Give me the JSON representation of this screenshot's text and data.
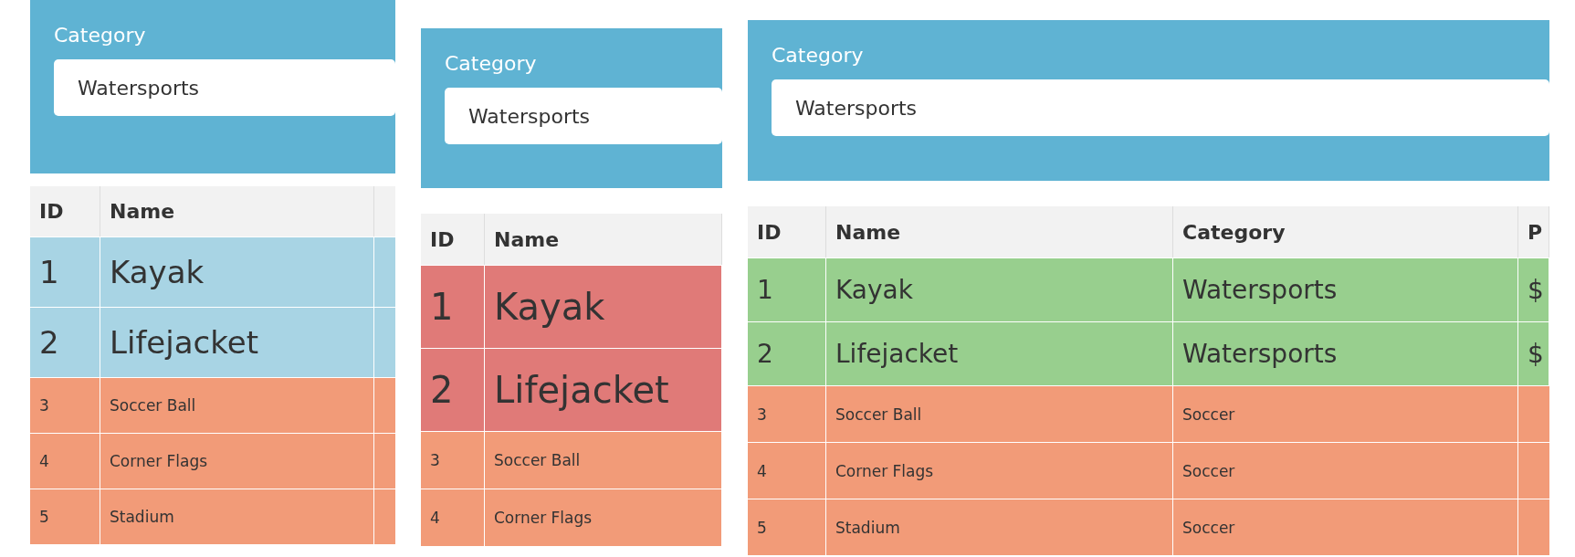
{
  "panels": [
    {
      "filter": {
        "label": "Category",
        "value": "Watersports"
      },
      "table": {
        "columns": [
          "ID",
          "Name"
        ],
        "rows": [
          {
            "kind": "large",
            "color": "#a8d4e4",
            "cells": [
              "1",
              "Kayak"
            ]
          },
          {
            "kind": "large",
            "color": "#a8d4e4",
            "cells": [
              "2",
              "Lifejacket"
            ]
          },
          {
            "kind": "small",
            "color": "#f29b78",
            "cells": [
              "3",
              "Soccer Ball"
            ]
          },
          {
            "kind": "small",
            "color": "#f29b78",
            "cells": [
              "4",
              "Corner Flags"
            ]
          },
          {
            "kind": "small",
            "color": "#f29b78",
            "cells": [
              "5",
              "Stadium"
            ]
          }
        ]
      }
    },
    {
      "filter": {
        "label": "Category",
        "value": "Watersports"
      },
      "table": {
        "columns": [
          "ID",
          "Name"
        ],
        "rows": [
          {
            "kind": "large",
            "color": "#e07a78",
            "cells": [
              "1",
              "Kayak"
            ]
          },
          {
            "kind": "large",
            "color": "#e07a78",
            "cells": [
              "2",
              "Lifejacket"
            ]
          },
          {
            "kind": "small",
            "color": "#f29b78",
            "cells": [
              "3",
              "Soccer Ball"
            ]
          },
          {
            "kind": "small",
            "color": "#f29b78",
            "cells": [
              "4",
              "Corner Flags"
            ]
          }
        ]
      }
    },
    {
      "filter": {
        "label": "Category",
        "value": "Watersports"
      },
      "table": {
        "columns": [
          "ID",
          "Name",
          "Category",
          "P"
        ],
        "rows": [
          {
            "kind": "large",
            "color": "#98cf8e",
            "cells": [
              "1",
              "Kayak",
              "Watersports",
              "$"
            ]
          },
          {
            "kind": "large",
            "color": "#98cf8e",
            "cells": [
              "2",
              "Lifejacket",
              "Watersports",
              "$"
            ]
          },
          {
            "kind": "small",
            "color": "#f29b78",
            "cells": [
              "3",
              "Soccer Ball",
              "Soccer"
            ]
          },
          {
            "kind": "small",
            "color": "#f29b78",
            "cells": [
              "4",
              "Corner Flags",
              "Soccer"
            ]
          },
          {
            "kind": "small",
            "color": "#f29b78",
            "cells": [
              "5",
              "Stadium",
              "Soccer"
            ]
          }
        ]
      }
    }
  ]
}
